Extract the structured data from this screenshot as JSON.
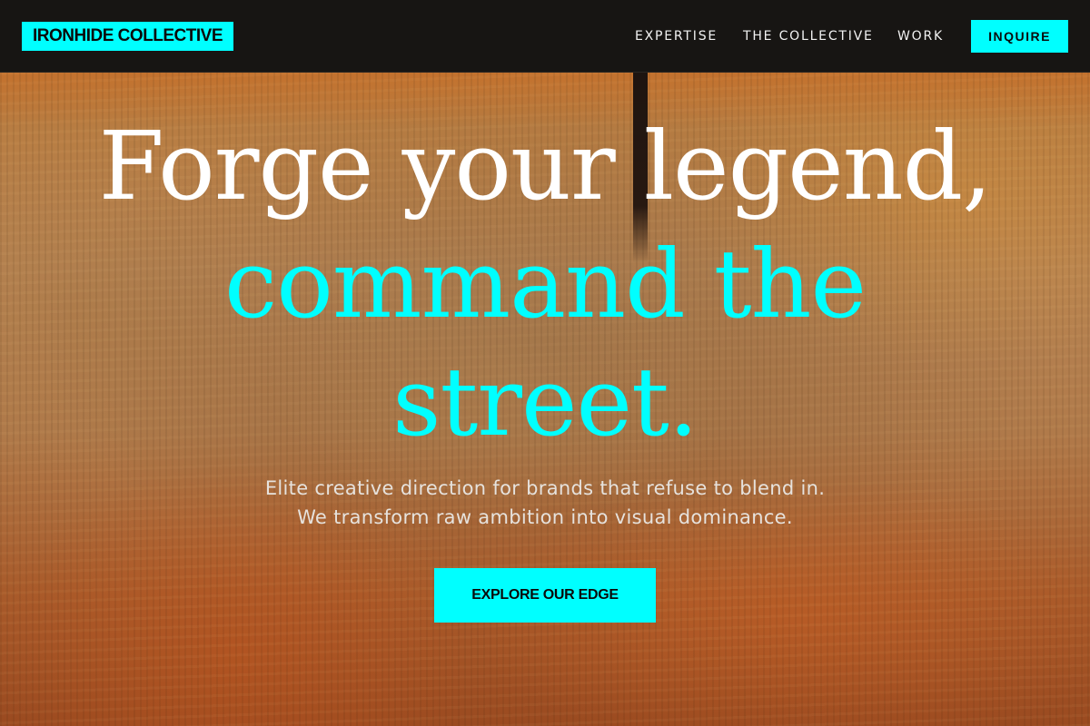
{
  "header": {
    "logo": "IRONHIDE COLLECTIVE",
    "nav": [
      {
        "label": "EXPERTISE"
      },
      {
        "label": "THE COLLECTIVE"
      },
      {
        "label": "WORK"
      }
    ],
    "cta_label": "INQUIRE"
  },
  "hero": {
    "headline": {
      "line1": "Forge your legend,",
      "line2": "command the",
      "line3": "street."
    },
    "subtitle": {
      "line1": "Elite creative direction for brands that refuse to blend in.",
      "line2": "We transform raw ambition into visual dominance."
    },
    "cta_label": "EXPLORE OUR EDGE"
  },
  "colors": {
    "accent": "#00ffff",
    "header_bg": "#171513",
    "headline_primary": "#ffffff"
  }
}
